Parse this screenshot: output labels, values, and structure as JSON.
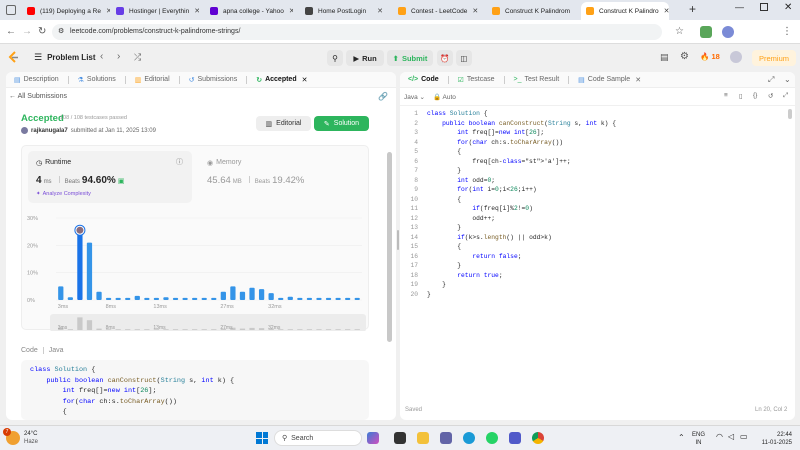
{
  "browser": {
    "tabs": [
      {
        "label": "(119) Deploying a Re",
        "icon": "youtube-icon",
        "color": "#ff0000"
      },
      {
        "label": "Hostinger | Everythin",
        "icon": "hostinger-icon",
        "color": "#673de6"
      },
      {
        "label": "apna college - Yahoo",
        "icon": "yahoo-icon",
        "color": "#6001d2"
      },
      {
        "label": "Home PostLogin",
        "icon": "home-icon",
        "color": "#444444"
      },
      {
        "label": "Contest - LeetCode",
        "icon": "leetcode-icon",
        "color": "#ffa116"
      },
      {
        "label": "Construct K Palindrom",
        "icon": "leetcode-icon",
        "color": "#ffa116"
      },
      {
        "label": "Construct K Palindro",
        "icon": "leetcode-icon",
        "color": "#ffa116"
      }
    ],
    "url": "leetcode.com/problems/construct-k-palindrome-strings/"
  },
  "lc_nav": {
    "problem_list": "Problem List",
    "run": "Run",
    "submit": "Submit",
    "streak": "18",
    "premium": "Premium"
  },
  "left_panel": {
    "tabs": [
      "Description",
      "Solutions",
      "Editorial",
      "Submissions",
      "Accepted"
    ],
    "all_submissions": "All Submissions",
    "status": "Accepted",
    "testcases": "108 / 108 testcases passed",
    "user": "rajkanugala7",
    "submitted": "submitted at Jan 11, 2025 13:09",
    "editorial_btn": "Editorial",
    "solution_btn": "Solution",
    "runtime": {
      "label": "Runtime",
      "value": "4",
      "unit": "ms",
      "beats_label": "Beats",
      "beats": "94.60%",
      "analyze": "Analyze Complexity"
    },
    "memory": {
      "label": "Memory",
      "value": "45.64",
      "unit": "MB",
      "beats_label": "Beats",
      "beats": "19.42%"
    },
    "code_lang_label": "Code",
    "code_lang": "Java",
    "code_preview": [
      "class Solution {",
      "    public boolean canConstruct(String s, int k) {",
      "        int freq[]=new int[26];",
      "        for(char ch:s.toCharArray())",
      "        {"
    ]
  },
  "chart_data": {
    "type": "bar",
    "title": "",
    "xlabel": "",
    "ylabel": "",
    "ylim": [
      0,
      30
    ],
    "yticks": [
      "30%",
      "20%",
      "10%",
      "0%"
    ],
    "xticks": [
      "3ms",
      "8ms",
      "13ms",
      "27ms",
      "32ms"
    ],
    "nav_ticks": [
      "3ms",
      "8ms",
      "13ms",
      "27ms",
      "32ms"
    ],
    "highlight_index": 2,
    "series": [
      {
        "values": [
          5,
          1,
          27,
          21,
          3,
          0.8,
          0.8,
          0.8,
          1.5,
          0.8,
          0.8,
          1,
          0.8,
          0.8,
          0.8,
          0.8,
          0.8,
          3,
          5,
          3,
          4.5,
          4,
          2.5,
          0.8,
          1.2,
          0.8,
          0.8,
          0.8,
          0.8,
          0.8,
          0.8,
          0.8
        ]
      }
    ]
  },
  "right_panel": {
    "tabs": [
      "Code",
      "Testcase",
      "Test Result",
      "Code Sample"
    ],
    "language": "Java",
    "auto": "Auto",
    "saved": "Saved",
    "cursor": "Ln 20, Col 2",
    "code": [
      "class Solution {",
      "    public boolean canConstruct(String s, int k) {",
      "        int freq[]=new int[26];",
      "        for(char ch:s.toCharArray())",
      "        {",
      "            freq[ch-'a']++;",
      "        }",
      "        int odd=0;",
      "        for(int i=0;i<26;i++)",
      "        {",
      "            if(freq[i]%2!=0)",
      "            odd++;",
      "        }",
      "        if(k>s.length() || odd>k)",
      "        {",
      "            return false;",
      "        }",
      "        return true;",
      "    }",
      "}"
    ]
  },
  "taskbar": {
    "temp": "24°C",
    "weather": "Haze",
    "badge": "7",
    "search": "Search",
    "lang1": "ENG",
    "lang2": "IN",
    "time": "22:44",
    "date": "11-01-2025"
  }
}
